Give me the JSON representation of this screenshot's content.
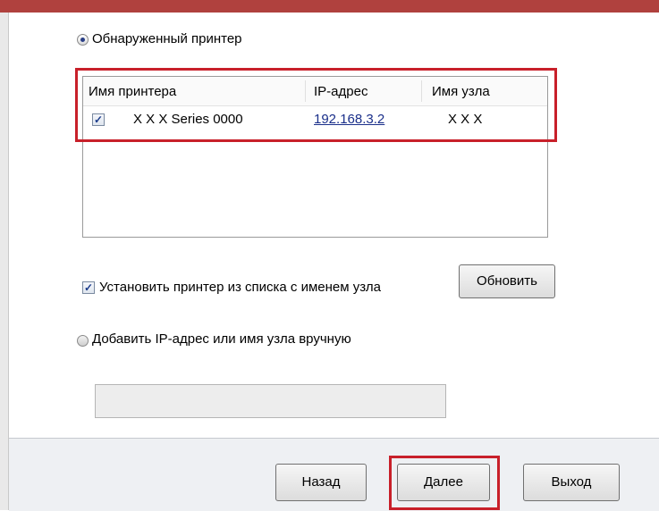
{
  "options": {
    "discovered_printer": "Обнаруженный принтер",
    "install_from_list": "Установить принтер из списка с именем узла",
    "add_manually": "Добавить IP-адрес или имя узла вручную"
  },
  "table": {
    "headers": [
      "Имя принтера",
      "IP-адрес",
      "Имя узла"
    ],
    "rows": [
      {
        "checked": true,
        "printer_name": "X X X  Series 0000",
        "ip": "192.168.3.2",
        "host": "X X X"
      }
    ]
  },
  "buttons": {
    "refresh": "Обновить",
    "back": "Назад",
    "next": "Далее",
    "exit": "Выход"
  },
  "manual_input": {
    "value": ""
  },
  "colors": {
    "highlight": "#c8202a",
    "link": "#1a2f8a"
  }
}
